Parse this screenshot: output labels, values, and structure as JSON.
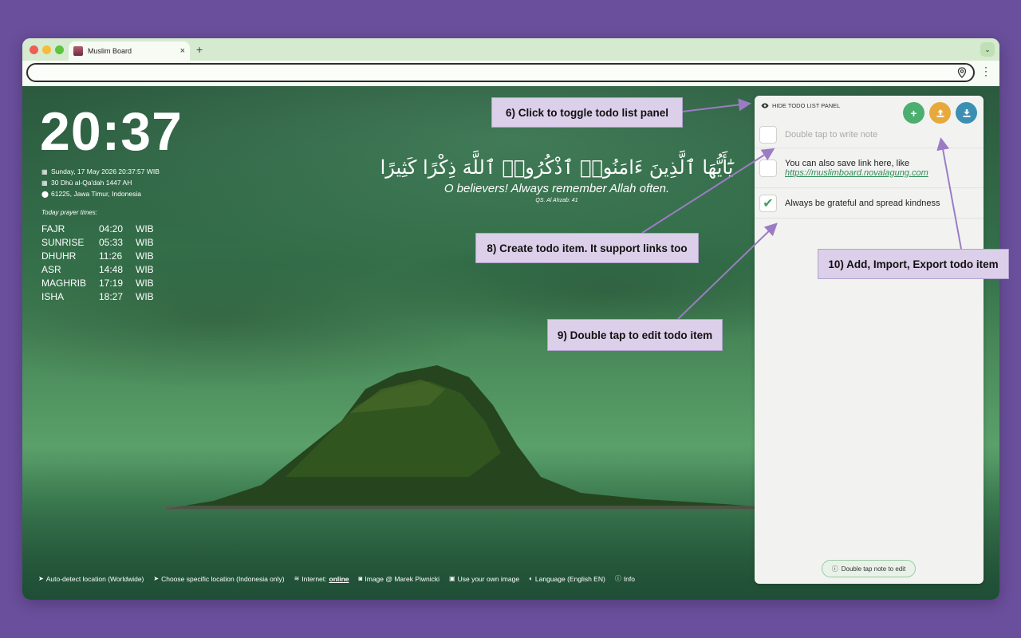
{
  "browser": {
    "tab_title": "Muslim Board",
    "tab_close": "×",
    "new_tab": "+",
    "window_menu": "⌄",
    "menu_dots": "⋮"
  },
  "dashboard": {
    "clock": "20:37",
    "date": "Sunday, 17 May 2026 20:37:57 WIB",
    "hijri": "30 Dhū al-Qa'dah 1447 AH",
    "location": "61225, Jawa Timur, Indonesia",
    "prayer_title": "Today prayer times:",
    "prayers": [
      {
        "name": "FAJR",
        "time": "04:20",
        "zone": "WIB"
      },
      {
        "name": "SUNRISE",
        "time": "05:33",
        "zone": "WIB"
      },
      {
        "name": "DHUHR",
        "time": "11:26",
        "zone": "WIB"
      },
      {
        "name": "ASR",
        "time": "14:48",
        "zone": "WIB"
      },
      {
        "name": "MAGHRIB",
        "time": "17:19",
        "zone": "WIB"
      },
      {
        "name": "ISHA",
        "time": "18:27",
        "zone": "WIB"
      }
    ],
    "quote_arabic": "يَٰٓأَيُّهَا ٱلَّذِينَ ءَامَنُوا۟ ٱذْكُرُوا۟ ٱللَّهَ ذِكْرًا كَثِيرًا",
    "quote_english": "O believers! Always remember Allah often.",
    "quote_source": "QS. Al Ahzab: 41"
  },
  "footer": {
    "auto_detect": "Auto-detect location (Worldwide)",
    "choose_location": "Choose specific location (Indonesia only)",
    "internet_label": "Internet:",
    "internet_status": "online",
    "image_credit": "Image @ Marek Piwnicki",
    "own_image": "Use your own image",
    "language": "Language (English EN)",
    "info": "Info"
  },
  "todo": {
    "hide_label": "HIDE TODO LIST PANEL",
    "placeholder": "Double tap to write note",
    "item1_text": "You can also save link here, like",
    "item1_link": "https://muslimboard.novalagung.com",
    "item2_text": "Always be grateful and spread kindness",
    "hint": "Double tap note to edit"
  },
  "annotations": {
    "toggle": "6) Click to toggle todo list panel",
    "create": "8) Create todo item. It support links too",
    "edit": "9) Double tap to edit todo item",
    "actions": "10) Add, Import, Export todo item"
  },
  "colors": {
    "background": "#6a4f9c",
    "add": "#4cae6f",
    "import": "#e8a93b",
    "export": "#3c8fb2",
    "callout": "#dccfe9"
  }
}
